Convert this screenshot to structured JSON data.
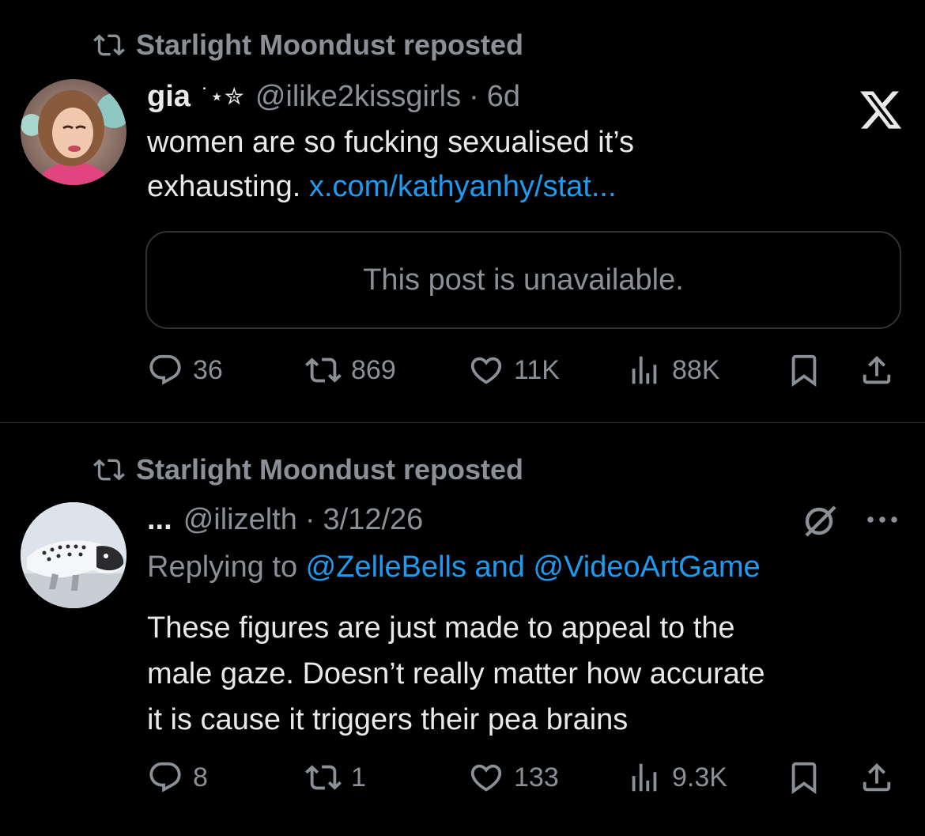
{
  "colors": {
    "background": "#000000",
    "text": "#e7e9ea",
    "muted": "#8b9096",
    "link": "#1d9bf0",
    "border": "#2f3336"
  },
  "posts": [
    {
      "repost_label": "Starlight Moondust reposted",
      "author_name": "gia",
      "author_decoration": "˙⋆✮",
      "handle": "@ilike2kissgirls",
      "separator": "·",
      "time": "6d",
      "text_part1": "women are so fucking sexualised it’s",
      "text_part2": "exhausting. ",
      "link_text": "x.com/kathyanhy/stat...",
      "quote_text": "This post is unavailable.",
      "stats": {
        "replies": "36",
        "reposts": "869",
        "likes": "11K",
        "views": "88K"
      },
      "icons": [
        "reply-icon",
        "repost-icon",
        "like-icon",
        "views-icon",
        "bookmark-icon",
        "share-icon",
        "x-logo-icon"
      ]
    },
    {
      "repost_label": "Starlight Moondust reposted",
      "author_name": "...",
      "handle": "@ilizelth",
      "separator": "·",
      "time": "3/12/26",
      "replying_prefix": "Replying to ",
      "replying_user1": "@ZelleBells",
      "replying_and": " and ",
      "replying_user2": "@VideoArtGame",
      "text_lines": [
        "These figures are just made to appeal to the",
        "male gaze. Doesn’t really matter how accurate",
        "it is cause it triggers their pea brains"
      ],
      "stats": {
        "replies": "8",
        "reposts": "1",
        "likes": "133",
        "views": "9.3K"
      },
      "icons": [
        "reply-icon",
        "repost-icon",
        "like-icon",
        "views-icon",
        "bookmark-icon",
        "share-icon",
        "grok-icon",
        "more-icon"
      ]
    }
  ]
}
